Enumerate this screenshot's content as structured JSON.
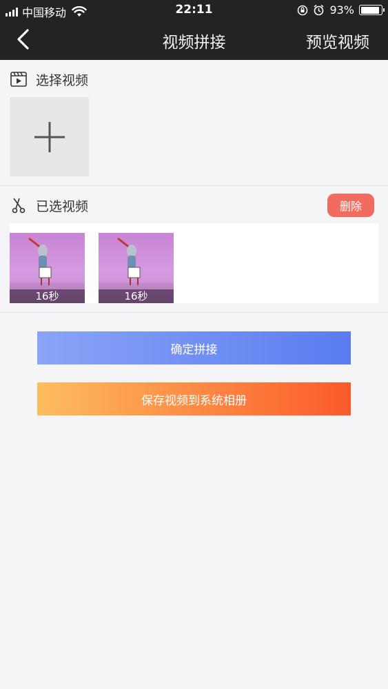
{
  "status_bar": {
    "carrier": "中国移动",
    "time": "22:11",
    "battery_percent": "93%",
    "battery_level": 0.93
  },
  "nav": {
    "title": "视频拼接",
    "preview_label": "预览视频"
  },
  "select_section": {
    "title": "选择视频"
  },
  "selected_section": {
    "title": "已选视频",
    "delete_label": "删除",
    "videos": [
      {
        "duration": "16秒"
      },
      {
        "duration": "16秒"
      }
    ]
  },
  "actions": {
    "confirm_label": "确定拼接",
    "save_label": "保存视频到系统相册"
  },
  "colors": {
    "nav_bg": "#232323",
    "delete": "#f26b5f",
    "confirm_gradient": [
      "#8aa4f7",
      "#5b7cf0"
    ],
    "save_gradient": [
      "#fdbd5e",
      "#fb5a2b"
    ]
  }
}
